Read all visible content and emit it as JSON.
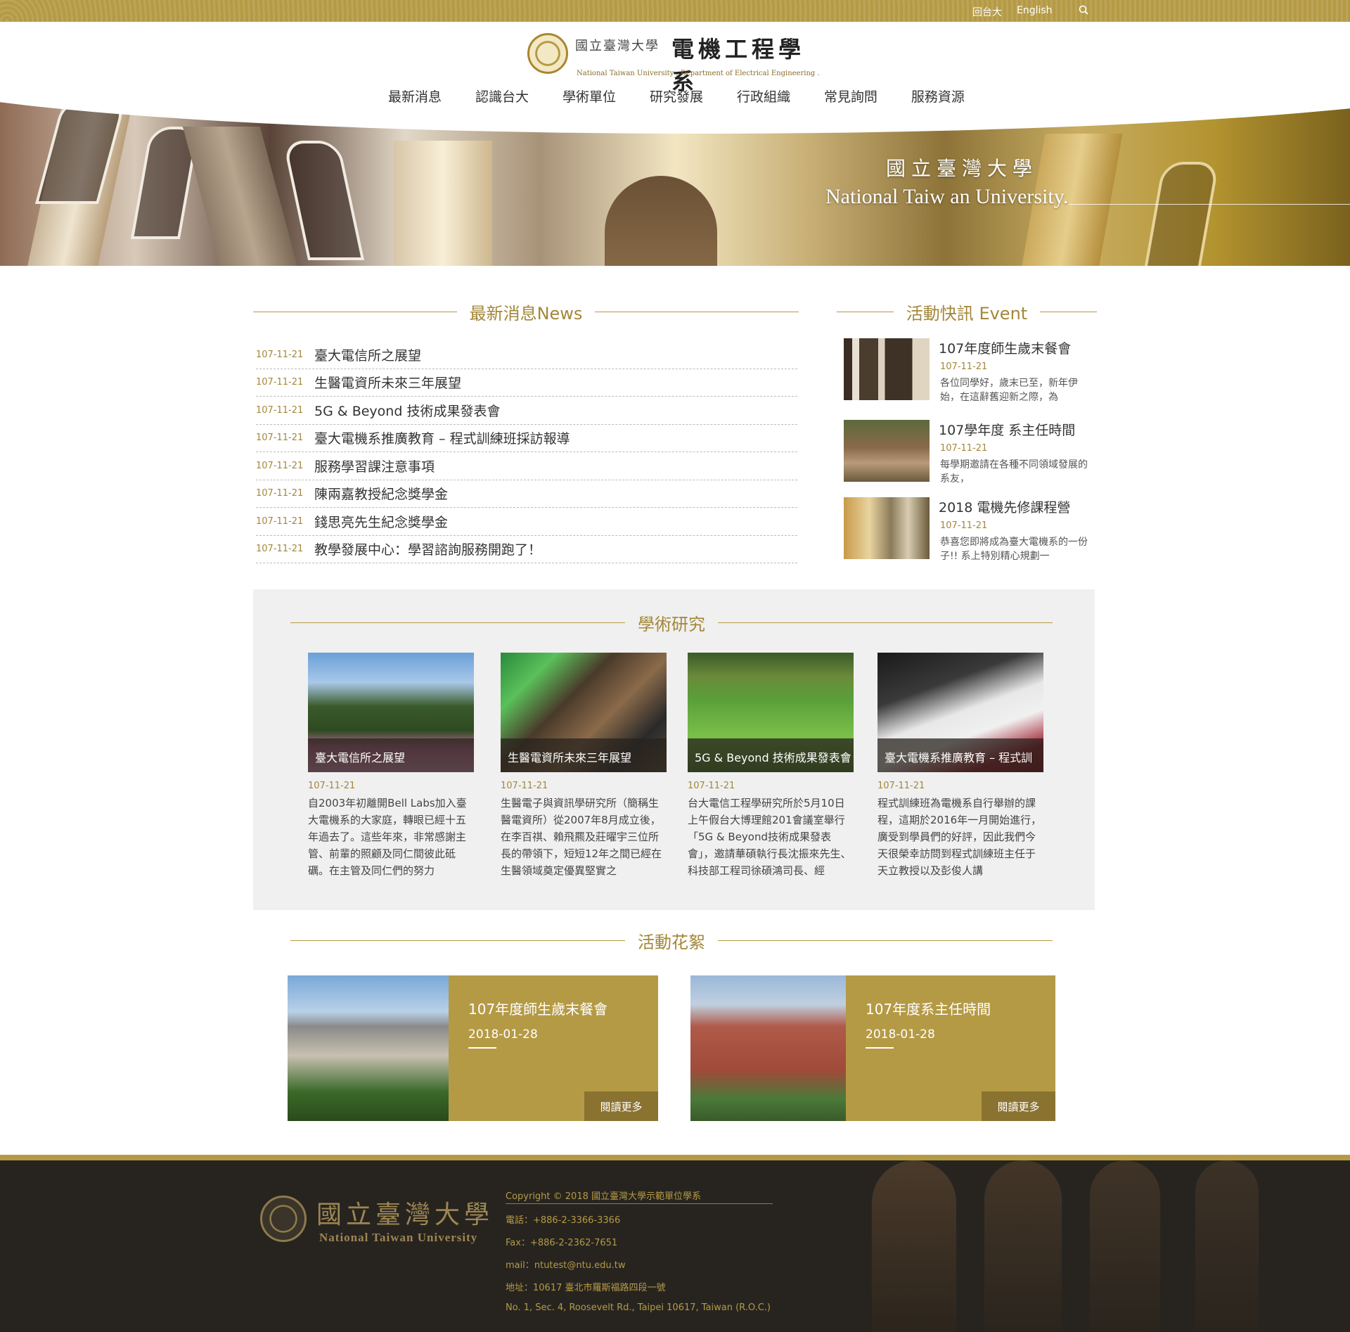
{
  "topbar": {
    "back_label": "回台大",
    "english_label": "English"
  },
  "logo": {
    "school_cn": "國立臺灣大學",
    "dept_cn": "電機工程學系",
    "en": "National Taiwan University , Department of Electrical Engineering ."
  },
  "nav": [
    "最新消息",
    "認識台大",
    "學術單位",
    "研究發展",
    "行政組織",
    "常見詢問",
    "服務資源"
  ],
  "hero": {
    "cn": "國立臺灣大學",
    "en": "National Taiw an University."
  },
  "news": {
    "title": "最新消息News",
    "items": [
      {
        "date": "107-11-21",
        "title": "臺大電信所之展望"
      },
      {
        "date": "107-11-21",
        "title": "生醫電資所未來三年展望"
      },
      {
        "date": "107-11-21",
        "title": "5G & Beyond 技術成果發表會"
      },
      {
        "date": "107-11-21",
        "title": "臺大電機系推廣教育 – 程式訓練班採訪報導"
      },
      {
        "date": "107-11-21",
        "title": "服務學習課注意事項"
      },
      {
        "date": "107-11-21",
        "title": "陳兩嘉教授紀念獎學金"
      },
      {
        "date": "107-11-21",
        "title": "錢思亮先生紀念獎學金"
      },
      {
        "date": "107-11-21",
        "title": "教學發展中心：學習諮詢服務開跑了！"
      }
    ]
  },
  "events": {
    "title": "活動快訊 Event",
    "items": [
      {
        "title": "107年度師生歲末餐會",
        "date": "107-11-21",
        "excerpt": "各位同學好，歲末已至，新年伊始，在這辭舊迎新之際，為"
      },
      {
        "title": "107學年度 系主任時間",
        "date": "107-11-21",
        "excerpt": "每學期邀請在各種不同領域發展的系友，"
      },
      {
        "title": "2018 電機先修課程營",
        "date": "107-11-21",
        "excerpt": "恭喜您即將成為臺大電機系的一份子!! 系上特別精心規劃一"
      }
    ]
  },
  "research": {
    "title": "學術研究",
    "items": [
      {
        "caption": "臺大電信所之展望",
        "date": "107-11-21",
        "excerpt": "自2003年初離開Bell Labs加入臺大電機系的大家庭，轉眼已經十五年過去了。這些年來，非常感謝主管、前輩的照顧及同仁間彼此砥礪。在主管及同仁們的努力"
      },
      {
        "caption": "生醫電資所未來三年展望",
        "date": "107-11-21",
        "excerpt": "生醫電子與資訊學研究所（簡稱生醫電資所）從2007年8月成立後，在李百祺、賴飛羆及莊曜宇三位所長的帶領下，短短12年之間已經在生醫領域奠定優異堅實之"
      },
      {
        "caption": "5G & Beyond 技術成果發表會",
        "date": "107-11-21",
        "excerpt": "台大電信工程學研究所於5月10日上午假台大博理館201會議室舉行「5G & Beyond技術成果發表會」，邀請華碩執行長沈振來先生、科技部工程司徐碩鴻司長、經"
      },
      {
        "caption": "臺大電機系推廣教育 – 程式訓",
        "date": "107-11-21",
        "excerpt": "程式訓練班為電機系自行舉辦的課程，這期於2016年一月開始進行，廣受到學員們的好評，因此我們今天很榮幸訪問到程式訓練班主任于天立教授以及彭俊人講"
      }
    ]
  },
  "gallery": {
    "title": "活動花絮",
    "more_label": "閱讀更多",
    "items": [
      {
        "title": "107年度師生歲末餐會",
        "date": "2018-01-28"
      },
      {
        "title": "107年度系主任時間",
        "date": "2018-01-28"
      }
    ]
  },
  "footer": {
    "school_cn": "國立臺灣大學",
    "school_en": "National Taiwan University",
    "copyright": "Copyright © 2018 國立臺灣大學示範單位學系",
    "phone": "電話：+886-2-3366-3366",
    "fax": "Fax：+886-2-2362-7651",
    "mail": "mail：ntutest@ntu.edu.tw",
    "address_cn": "地址：10617 臺北市羅斯福路四段一號",
    "address_en": "No. 1, Sec. 4, Roosevelt Rd., Taipei 10617, Taiwan (R.O.C.)"
  },
  "colors": {
    "gold": "#b59a45",
    "dark_gold": "#8a7230",
    "footer_bg": "#272420"
  }
}
